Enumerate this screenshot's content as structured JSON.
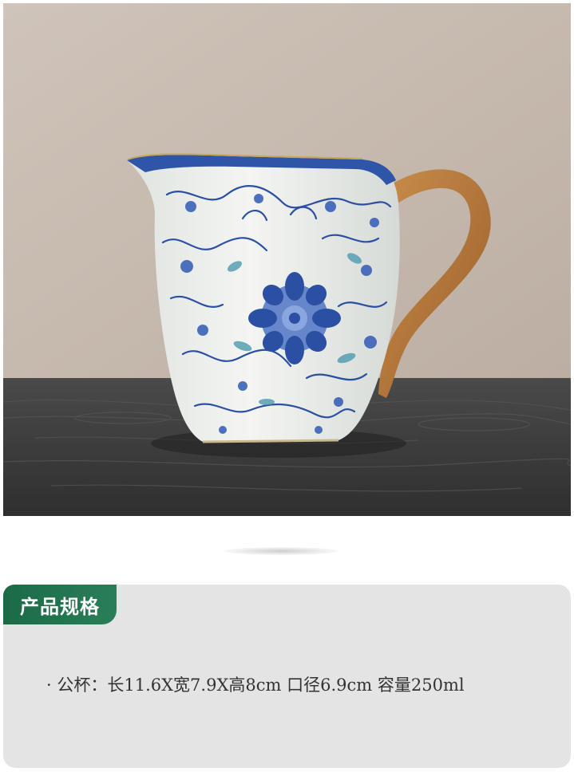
{
  "image": {
    "subject": "blue-and-white-porcelain-pitcher-icon",
    "colors": {
      "wall": "#c9bdb3",
      "table": "#3d3d3d",
      "porcelain": "#eef0ee",
      "pattern": "#2b4fa3",
      "handle": "#b7793a"
    }
  },
  "spec": {
    "title": "产品规格",
    "line": "· 公杯：长11.6X宽7.9X高8cm   口径6.9cm 容量250ml"
  }
}
